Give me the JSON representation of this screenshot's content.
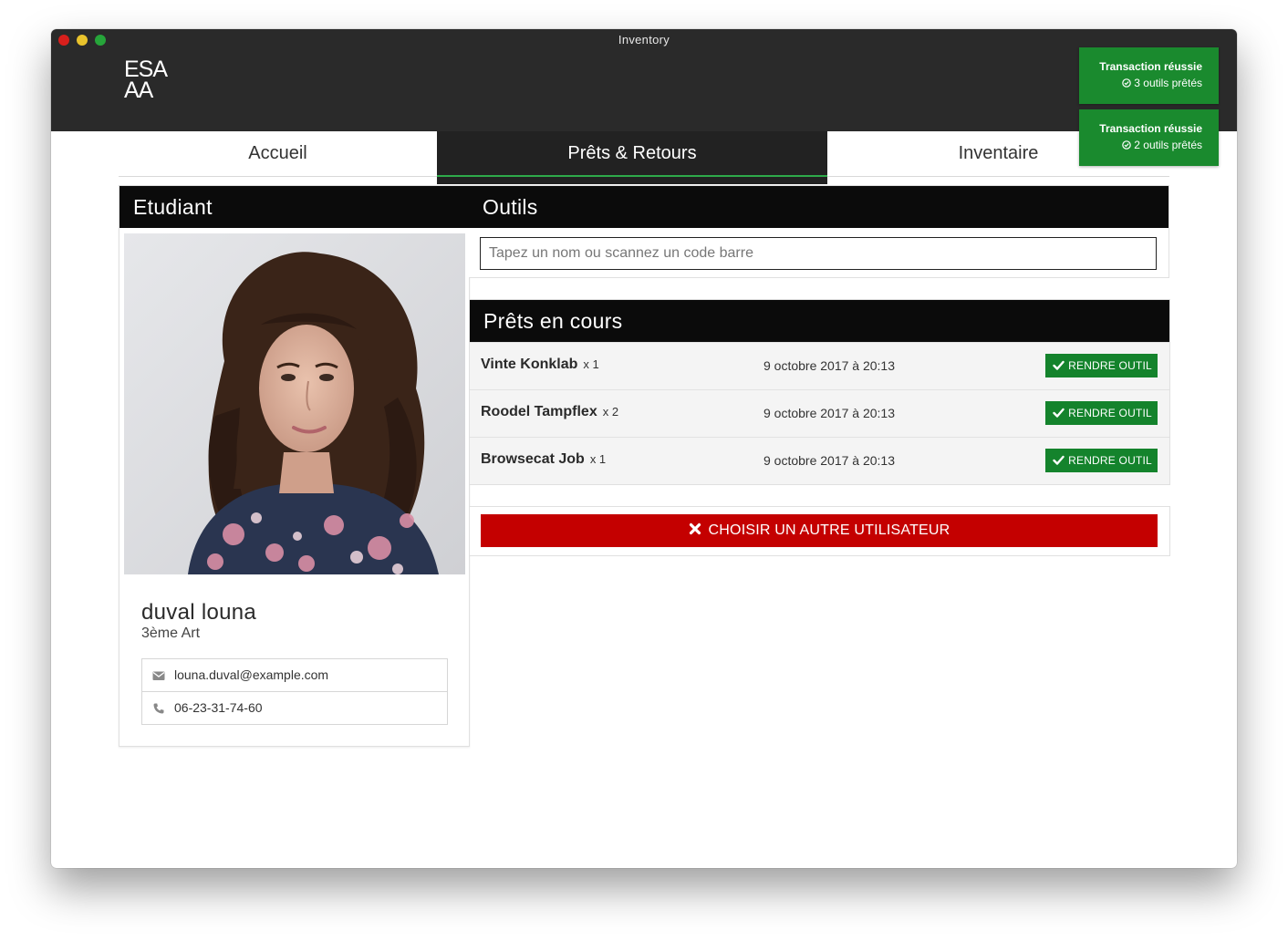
{
  "window": {
    "title": "Inventory"
  },
  "brand": {
    "logo_line1": "ESA",
    "logo_line2": "AA"
  },
  "nav": {
    "tabs": [
      {
        "label": "Accueil",
        "active": false
      },
      {
        "label": "Prêts & Retours",
        "active": true
      },
      {
        "label": "Inventaire",
        "active": false
      }
    ]
  },
  "student": {
    "header": "Etudiant",
    "name": "duval louna",
    "class": "3ème Art",
    "email": "louna.duval@example.com",
    "phone": "06-23-31-74-60"
  },
  "tools": {
    "header": "Outils",
    "search_placeholder": "Tapez un nom ou scannez un code barre"
  },
  "loans": {
    "header": "Prêts en cours",
    "return_label": "RENDRE OUTIL",
    "items": [
      {
        "name": "Vinte Konklab",
        "qty": "x 1",
        "date": "9 octobre 2017 à 20:13"
      },
      {
        "name": "Roodel Tampflex",
        "qty": "x 2",
        "date": "9 octobre 2017 à 20:13"
      },
      {
        "name": "Browsecat Job",
        "qty": "x 1",
        "date": "9 octobre 2017 à 20:13"
      }
    ]
  },
  "actions": {
    "choose_other_user": "CHOISIR UN AUTRE UTILISATEUR"
  },
  "toasts": [
    {
      "title": "Transaction réussie",
      "message": "3 outils prêtés"
    },
    {
      "title": "Transaction réussie",
      "message": "2 outils prêtés"
    }
  ],
  "colors": {
    "header_bg": "#2a2a2a",
    "panel_header_bg": "#0b0b0b",
    "accent_green": "#2eaa4a",
    "success_green": "#14832c",
    "danger_red": "#c40000"
  }
}
